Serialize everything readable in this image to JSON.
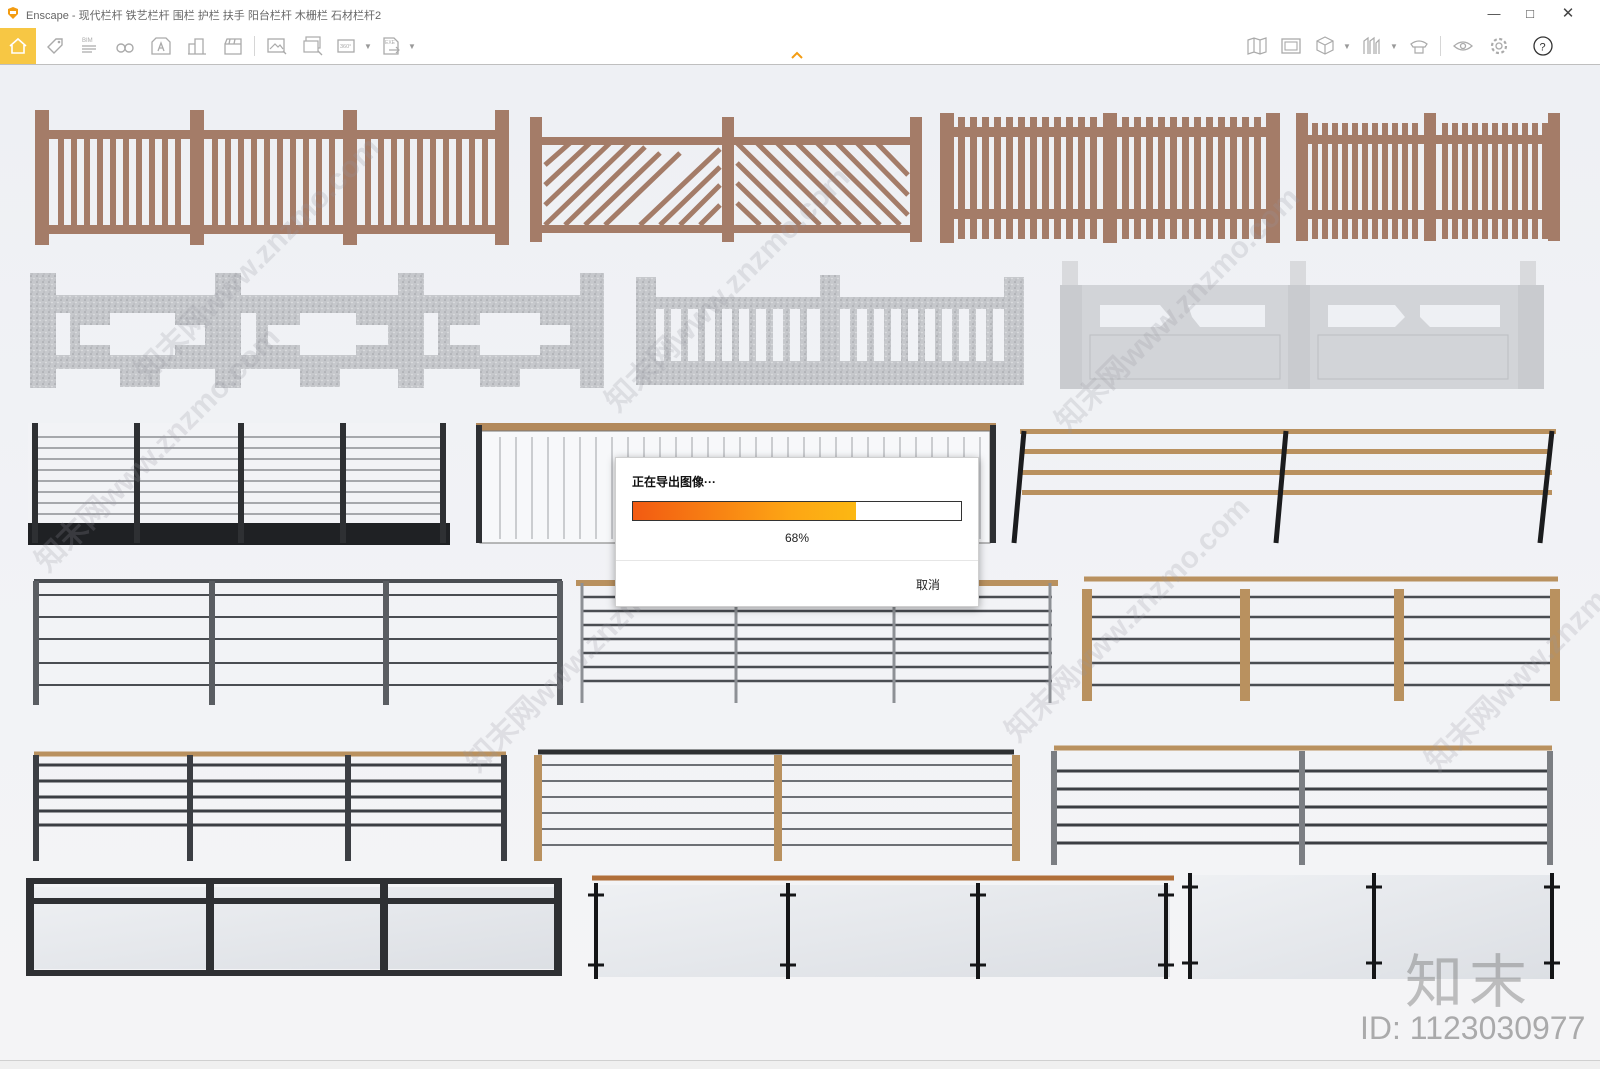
{
  "window": {
    "title": "Enscape - 现代栏杆 铁艺栏杆 围栏 护栏 扶手 阳台栏杆 木栅栏 石材栏杆2",
    "controls": [
      "minimize",
      "maximize",
      "close"
    ]
  },
  "toolbar": {
    "left_tools": [
      {
        "name": "home-icon"
      },
      {
        "name": "tag-icon"
      },
      {
        "name": "bim-icon",
        "label": "BIM"
      },
      {
        "name": "binoculars-icon"
      },
      {
        "name": "material-icon"
      },
      {
        "name": "buildings-icon"
      },
      {
        "name": "clapper-icon"
      },
      {
        "name": "screenshot-icon"
      },
      {
        "name": "batch-render-icon"
      },
      {
        "name": "panorama-icon",
        "label": "360°"
      },
      {
        "name": "export-exe-icon",
        "label": "EXE"
      }
    ],
    "right_tools": [
      {
        "name": "map-icon"
      },
      {
        "name": "gallery-icon"
      },
      {
        "name": "cube-icon"
      },
      {
        "name": "sections-icon"
      },
      {
        "name": "asset-icon"
      },
      {
        "name": "eye-icon"
      },
      {
        "name": "gear-icon"
      },
      {
        "name": "help-icon"
      }
    ]
  },
  "dialog": {
    "title": "正在导出图像···",
    "progress": 0.68,
    "percent_text": "68%",
    "cancel_label": "取消",
    "progress_colors": [
      "#f25a12",
      "#fcb813"
    ]
  },
  "watermark": {
    "text": "知末网www.znzmo.com",
    "brand": "知末",
    "id_text": "ID: 1123030977"
  },
  "colors": {
    "wood": "#a47c68",
    "stone": "#c9cbcf",
    "metal": "#2e3033",
    "timber_rail": "#b9915f",
    "glass": "#e4e6ea"
  }
}
